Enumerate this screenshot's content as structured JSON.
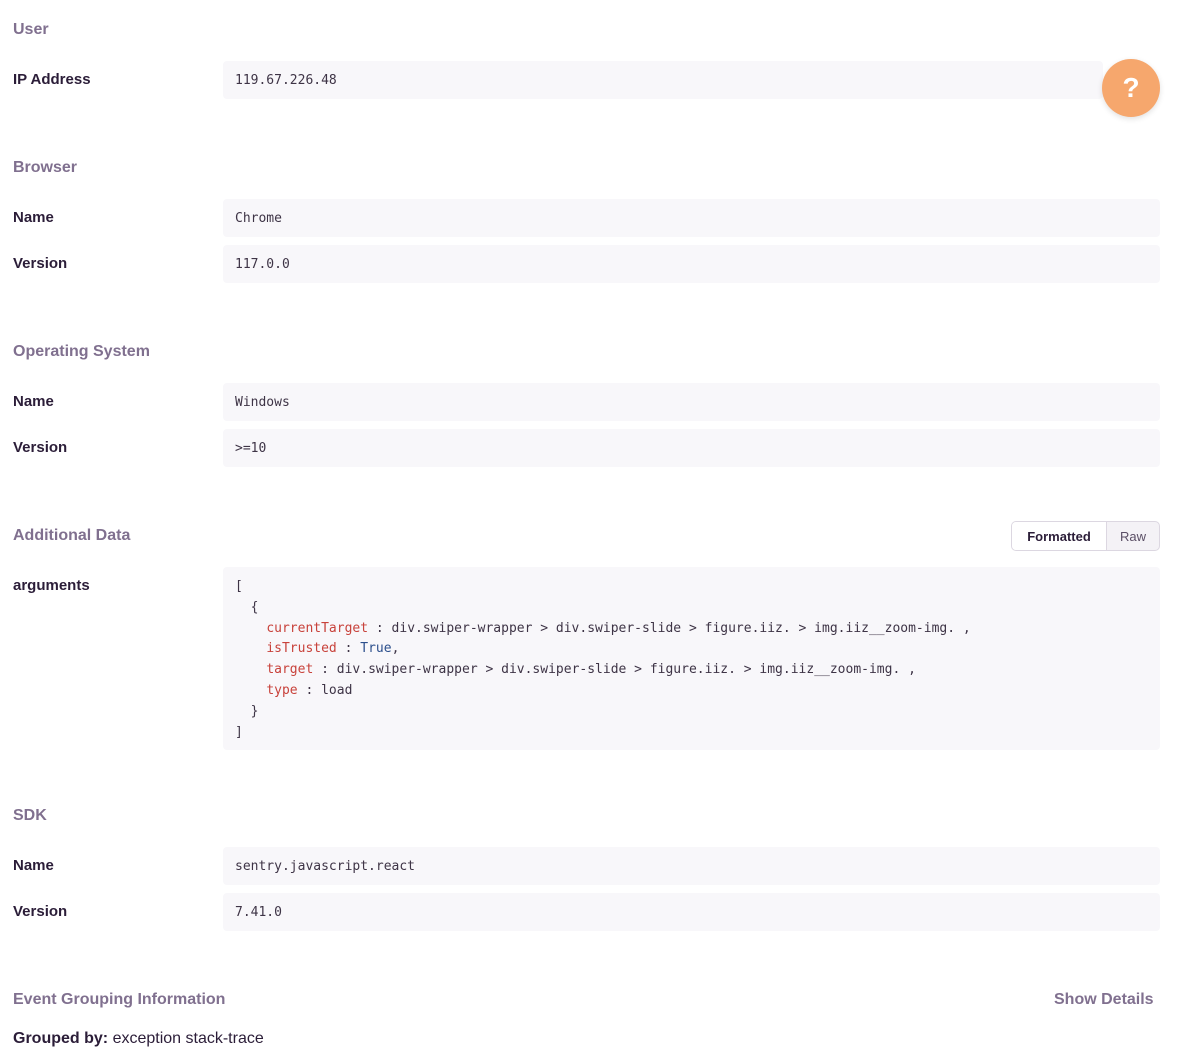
{
  "user": {
    "title": "User",
    "ip_label": "IP Address",
    "ip_value": "119.67.226.48"
  },
  "help_button": {
    "icon": "question-icon",
    "glyph": "?"
  },
  "browser": {
    "title": "Browser",
    "name_label": "Name",
    "name_value": "Chrome",
    "version_label": "Version",
    "version_value": "117.0.0"
  },
  "os": {
    "title": "Operating System",
    "name_label": "Name",
    "name_value": "Windows",
    "version_label": "Version",
    "version_value": ">=10"
  },
  "additional_data": {
    "title": "Additional Data",
    "toggle": {
      "formatted": "Formatted",
      "raw": "Raw",
      "selected": "Formatted"
    },
    "arguments_label": "arguments",
    "code": {
      "open_bracket": "[",
      "open_brace": "{",
      "entries": [
        {
          "key": "currentTarget",
          "sep": " : ",
          "value": "div.swiper-wrapper > div.swiper-slide > figure.iiz. > img.iiz__zoom-img. ,",
          "kind": "string"
        },
        {
          "key": "isTrusted",
          "sep": " : ",
          "value": "True",
          "suffix": ",",
          "kind": "bool"
        },
        {
          "key": "target",
          "sep": " : ",
          "value": "div.swiper-wrapper > div.swiper-slide > figure.iiz. > img.iiz__zoom-img. ,",
          "kind": "string"
        },
        {
          "key": "type",
          "sep": " : ",
          "value": "load",
          "kind": "string"
        }
      ],
      "close_brace": "}",
      "close_bracket": "]"
    }
  },
  "sdk": {
    "title": "SDK",
    "name_label": "Name",
    "name_value": "sentry.javascript.react",
    "version_label": "Version",
    "version_value": "7.41.0"
  },
  "grouping": {
    "title": "Event Grouping Information",
    "show_details": "Show Details",
    "grouped_by_label": "Grouped by:",
    "grouped_by_value": "exception stack-trace"
  },
  "colors": {
    "section_title": "#80708f",
    "label": "#2b1d38",
    "value_bg": "#f8f7fa",
    "help_button": "#f6a76d",
    "code_key": "#c8423b",
    "code_bool": "#2c4f8c"
  }
}
